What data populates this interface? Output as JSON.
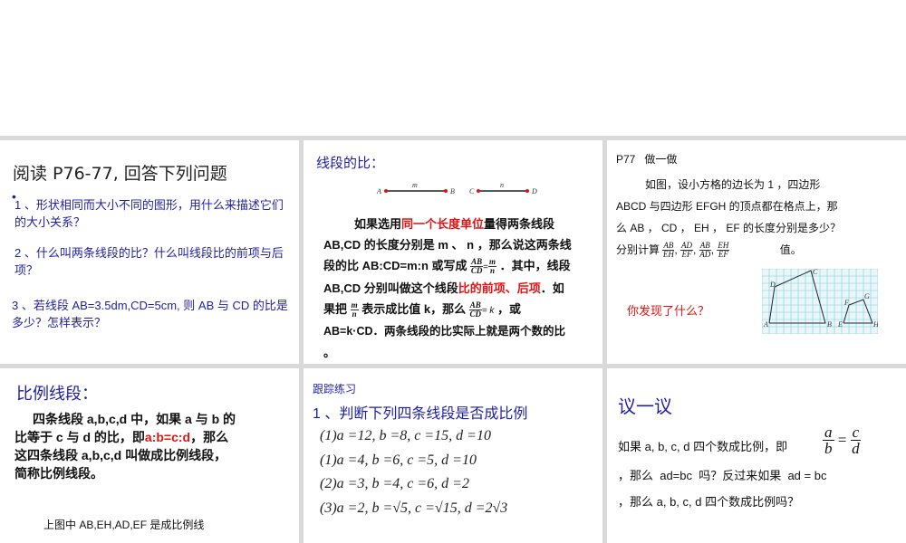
{
  "panel1": {
    "title": "阅读 P76-77, 回答下列问题",
    "bullet": "•",
    "q1": "1 、形状相同而大小不同的图形，用什么来描述它们的大小关系？",
    "q2": "2 、什么叫两条线段的比？什么叫线段比的前项与后项？",
    "q3": "3 、若线段 AB=3.5dm,CD=5cm, 则 AB 与 CD 的比是多少？怎样表示？"
  },
  "panel2": {
    "title": "线段的比：",
    "diagram": {
      "A": "A",
      "B": "B",
      "C": "C",
      "D": "D",
      "m": "m",
      "n": "n"
    },
    "line1_a": "如果选用",
    "line1_red": "同一个长度单位",
    "line1_b": "量得两条线段",
    "line2": "AB,CD 的长度分别是 m 、 n ，那么说这两条线",
    "line3_a": "段的比 AB:CD=m:n 或写成",
    "line3_frac1_num": "AB",
    "line3_frac1_den": "CD",
    "line3_eq": "=",
    "line3_frac2_num": "m",
    "line3_frac2_den": "n",
    "line3_b": "．其中，线段",
    "line4_a": "AB,CD 分别叫做这个线段",
    "line4_red": "比的前项、后项",
    "line4_b": "．如",
    "line5_a": "果把",
    "line5_frac_num": "m",
    "line5_frac_den": "n",
    "line5_b": "表示成比值 k，那么",
    "line5_frac2_num": "AB",
    "line5_frac2_den": "CD",
    "line5_eqk": "= k",
    "line5_c": "，或",
    "line6": "AB=k·CD．两条线段的比实际上就是两个数的比",
    "line7": "。"
  },
  "panel3": {
    "heading": "P77   做一做",
    "line1": "如图，设小方格的边长为 1 ，四边形",
    "line2": "ABCD 与四边形 EFGH 的顶点都在格点上，那",
    "line3": "么 AB ， CD ， EH ， EF 的长度分别是多少？",
    "line4_a": "分别计算",
    "fracs": [
      {
        "num": "AB",
        "den": "EH"
      },
      {
        "num": "AD",
        "den": "EF"
      },
      {
        "num": "AB",
        "den": "AD"
      },
      {
        "num": "EH",
        "den": "EF"
      }
    ],
    "line4_b": "值。",
    "question": "你发现了什么？",
    "grid_labels": {
      "A": "A",
      "B": "B",
      "C": "C",
      "D": "D",
      "E": "E",
      "F": "F",
      "G": "G",
      "H": "H"
    }
  },
  "panel4": {
    "title": "比例线段：",
    "line1": "四条线段 a,b,c,d 中，如果 a 与 b 的",
    "line2_a": "比等于 c 与 d 的比，即",
    "line2_red": "a:b=c:d",
    "line2_b": "，那么",
    "line3": "这四条线段 a,b,c,d 叫做成比例线段，",
    "line4": "简称比例线段。",
    "footer": "上图中 AB,EH,AD,EF 是成比例线"
  },
  "panel5": {
    "heading": "跟踪练习",
    "title": "1 、判断下列四条线段是否成比例",
    "items": [
      "(1)a =12, b =8, c =15, d =10",
      "(1)a =4, b =6, c =5, d =10",
      "(2)a =3, b =4, c =6, d =2",
      "(3)a =2, b =√5, c =√15, d =2√3"
    ]
  },
  "panel6": {
    "title": "议一议",
    "line1_a": "如果 a, b, c, d 四个数成比例，即",
    "frac_a": "a",
    "frac_b": "b",
    "eq": "=",
    "frac_c": "c",
    "frac_d": "d",
    "line2": "，那么  ad=bc  吗？反过来如果  ad = bc",
    "line3": "，那么 a, b, c, d 四个数成比例吗？"
  }
}
